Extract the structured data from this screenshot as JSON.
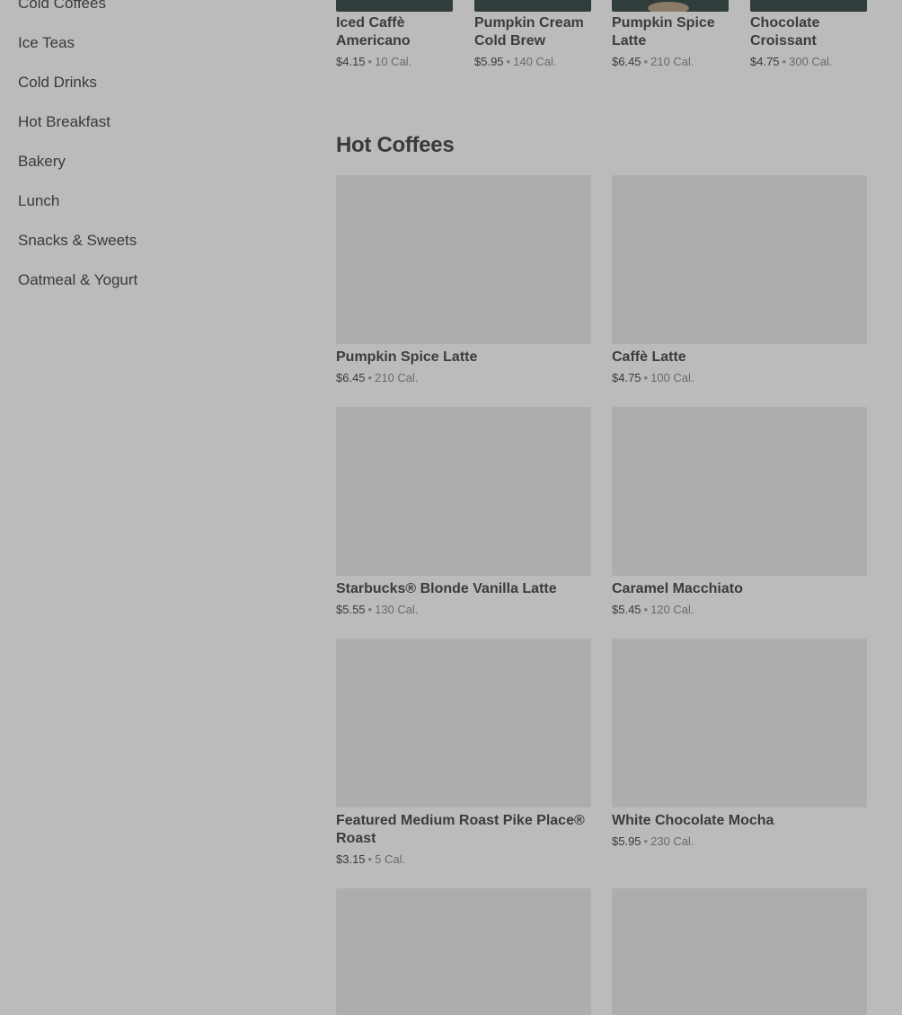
{
  "sidebar": {
    "items": [
      {
        "label": "Cold Coffees"
      },
      {
        "label": "Ice Teas"
      },
      {
        "label": "Cold Drinks"
      },
      {
        "label": "Hot Breakfast"
      },
      {
        "label": "Bakery"
      },
      {
        "label": "Lunch"
      },
      {
        "label": "Snacks & Sweets"
      },
      {
        "label": "Oatmeal & Yogurt"
      }
    ]
  },
  "featured": {
    "items": [
      {
        "name": "Iced Caffè Americano",
        "price": "$4.15",
        "calories": "10 Cal."
      },
      {
        "name": "Pumpkin Cream Cold Brew",
        "price": "$5.95",
        "calories": "140 Cal."
      },
      {
        "name": "Pumpkin Spice Latte",
        "price": "$6.45",
        "calories": "210 Cal."
      },
      {
        "name": "Chocolate Croissant",
        "price": "$4.75",
        "calories": "300 Cal."
      }
    ]
  },
  "hot_coffees": {
    "title": "Hot Coffees",
    "items": [
      {
        "name": "Pumpkin Spice Latte",
        "price": "$6.45",
        "calories": "210 Cal."
      },
      {
        "name": "Caffè Latte",
        "price": "$4.75",
        "calories": "100 Cal."
      },
      {
        "name": "Starbucks® Blonde Vanilla Latte",
        "price": "$5.55",
        "calories": "130 Cal."
      },
      {
        "name": "Caramel Macchiato",
        "price": "$5.45",
        "calories": "120 Cal."
      },
      {
        "name": "Featured Medium Roast Pike Place® Roast",
        "price": "$3.15",
        "calories": "5 Cal."
      },
      {
        "name": "White Chocolate Mocha",
        "price": "$5.95",
        "calories": "230 Cal."
      }
    ],
    "separator": "•"
  },
  "colors": {
    "background": "#bbbbbb",
    "thumb_placeholder": "#adadad",
    "dark_thumb": "#2f3e3c",
    "text": "#3c3c3c"
  }
}
